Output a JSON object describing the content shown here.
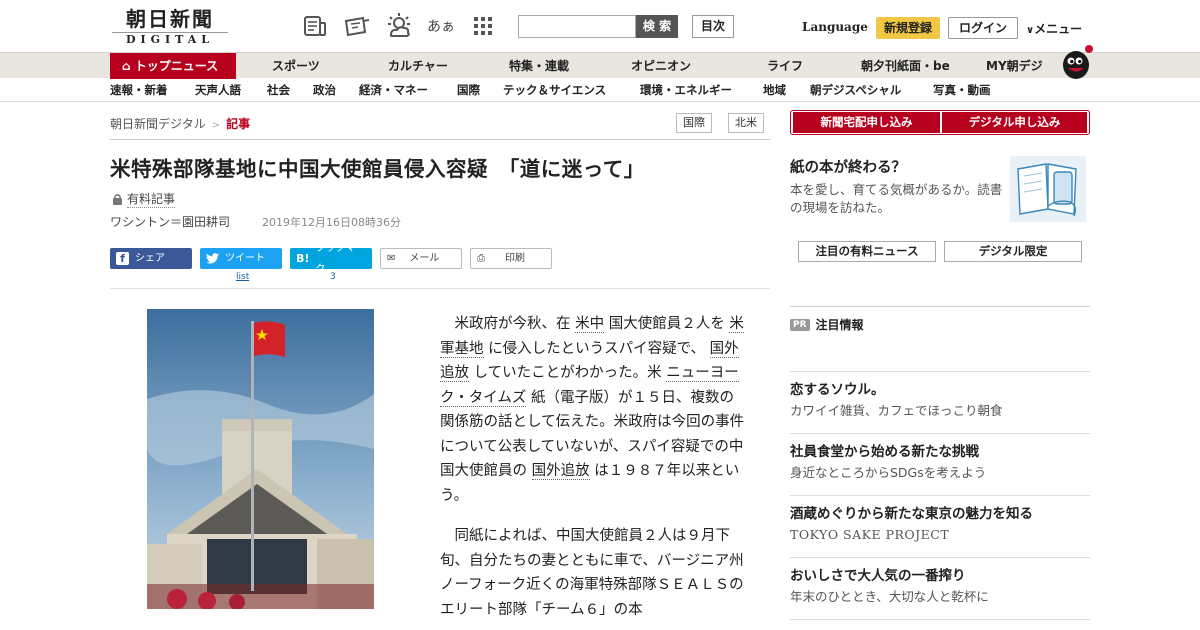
{
  "header": {
    "logo_jp": "朝日新聞",
    "logo_en": "DIGITAL",
    "icons": [
      "paper-icon",
      "digital-icon",
      "weather-icon",
      "furigana-icon",
      "grid-icon"
    ],
    "furigana_label": "あぁ",
    "search_placeholder": "",
    "search_button": "検 索",
    "index_button": "目次",
    "language": "Language",
    "register": "新規登録",
    "login": "ログイン",
    "menu": "メニュー",
    "accent": "#b7001e"
  },
  "nav_primary": {
    "top_news": "トップニュース",
    "items": [
      "スポーツ",
      "カルチャー",
      "特集・連載",
      "オピニオン",
      "ライフ",
      "朝夕刊紙面・be",
      "MY朝デジ"
    ]
  },
  "nav_secondary": {
    "items": [
      "速報・新着",
      "天声人語",
      "社会",
      "政治",
      "経済・マネー",
      "国際",
      "テック＆サイエンス",
      "環境・エネルギー",
      "地域",
      "朝デジスペシャル",
      "写真・動画"
    ]
  },
  "breadcrumb": {
    "home": "朝日新聞デジタル",
    "separator": ">",
    "current": "記事"
  },
  "tags": [
    "国際",
    "北米"
  ],
  "article": {
    "title": "米特殊部隊基地に中国大使館員侵入容疑　「道に迷って」",
    "paid_label": "有料記事",
    "byline": "ワシントン＝園田耕司",
    "date": "2019年12月16日08時36分",
    "share": {
      "facebook": "シェア",
      "twitter": "ツイート",
      "twitter_count": "list",
      "hatena": "ブックマーク",
      "hatena_count": "3",
      "mail": "メール",
      "print": "印刷"
    },
    "p1": {
      "a": "米政府が今秋、在",
      "kw1": "米中",
      "b": "国大使館員２人を",
      "kw2": "米軍基地",
      "c": "に侵入したというスパイ容疑で、",
      "kw3": "国外追放",
      "d": "していたことがわかった。米",
      "kw4": "ニューヨーク・タイムズ",
      "e": "紙（電子版）が１５日、複数の関係筋の話として伝えた。米政府は今回の事件について公表していないが、スパイ容疑での中国大使館員の",
      "kw5": "国外追放",
      "f": "は１９８７年以来という。"
    },
    "p2": "同紙によれば、中国大使館員２人は９月下旬、自分たちの妻とともに車で、バージニア州ノーフォーク近くの海軍特殊部隊ＳＥＡＬＳのエリート部隊「チーム６」の本"
  },
  "sidebar": {
    "subscribe_paper": "新聞宅配申し込み",
    "subscribe_digital": "デジタル申し込み",
    "paper_feature": {
      "title": "紙の本が終わる？",
      "desc": "本を愛し、育てる気概があるか。読書の現場を訪ねた。"
    },
    "pill_left": "注目の有料ニュース",
    "pill_right": "デジタル限定",
    "pr_badge": "PR",
    "pr_heading": "注目情報",
    "pr_items": [
      {
        "title": "恋するソウル。",
        "sub": "カワイイ雑貨、カフェでほっこり朝食"
      },
      {
        "title": "社員食堂から始める新たな挑戦",
        "sub": "身近なところからSDGsを考えよう"
      },
      {
        "title": "酒蔵めぐりから新たな東京の魅力を知る",
        "sub": "TOKYO SAKE PROJECT"
      },
      {
        "title": "おいしさで大人気の一番搾り",
        "sub": "年末のひととき、大切な人と乾杯に"
      }
    ]
  }
}
